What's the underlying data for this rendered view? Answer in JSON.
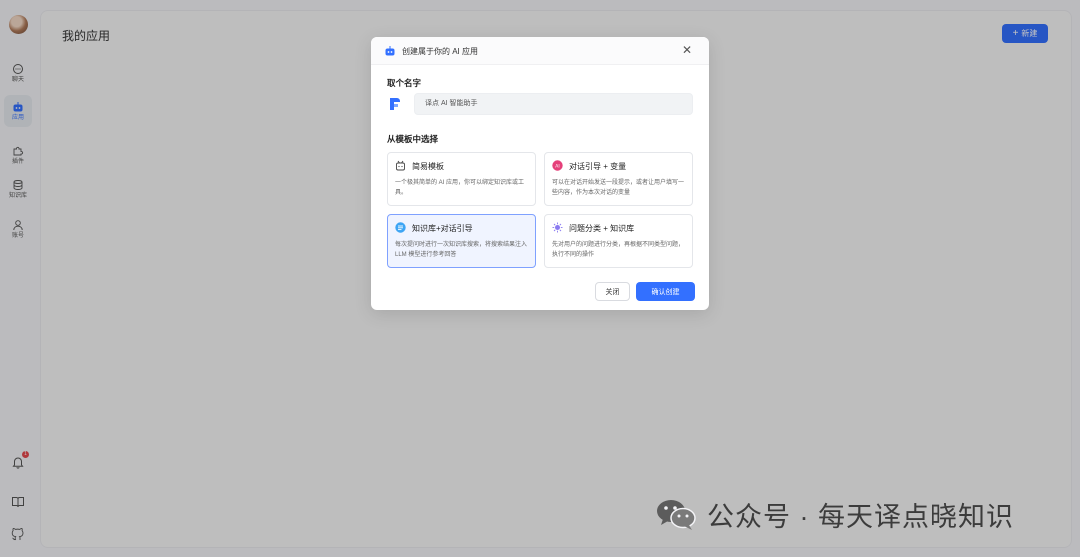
{
  "sidebar": {
    "items": [
      {
        "label": "聊天",
        "icon": "chat-icon"
      },
      {
        "label": "应用",
        "icon": "robot-icon"
      },
      {
        "label": "插件",
        "icon": "puzzle-icon"
      },
      {
        "label": "知识库",
        "icon": "database-icon"
      },
      {
        "label": "账号",
        "icon": "user-icon"
      }
    ],
    "notification_count": "1",
    "bottom_icons": [
      "bell-icon",
      "book-icon",
      "github-icon"
    ]
  },
  "main": {
    "title": "我的应用",
    "new_button_label": "新建",
    "new_button_icon": "+"
  },
  "modal": {
    "title": "创建属于你的 AI 应用",
    "close_symbol": "✕",
    "name_section_label": "取个名字",
    "name_input_value": "译点 AI 智能助手",
    "template_section_label": "从模板中选择",
    "templates": [
      {
        "title": "简易模板",
        "desc": "一个极其简单的 AI 应用，你可以绑定知识库或工具。",
        "icon": "simple-template-icon",
        "selected": false
      },
      {
        "title": "对话引导 + 变量",
        "desc": "可以在对话开始发送一段提示，或者让用户填写一些内容，作为本次对话的变量",
        "icon": "ai-guide-icon",
        "selected": false
      },
      {
        "title": "知识库+对话引导",
        "desc": "每次提问时进行一次知识库搜索，将搜索结果注入 LLM 模型进行参考回答",
        "icon": "knowledge-icon",
        "selected": true
      },
      {
        "title": "问题分类 + 知识库",
        "desc": "先对用户的问题进行分类，再根据不同类型问题，执行不同的操作",
        "icon": "classify-icon",
        "selected": false
      }
    ],
    "cancel_label": "关闭",
    "confirm_label": "确认创建"
  },
  "watermark": {
    "text": "公众号 · 每天译点晓知识",
    "icon": "wechat-icon"
  },
  "colors": {
    "accent": "#3370ff",
    "selected_bg": "#f0f4ff",
    "badge": "#e5484d"
  }
}
